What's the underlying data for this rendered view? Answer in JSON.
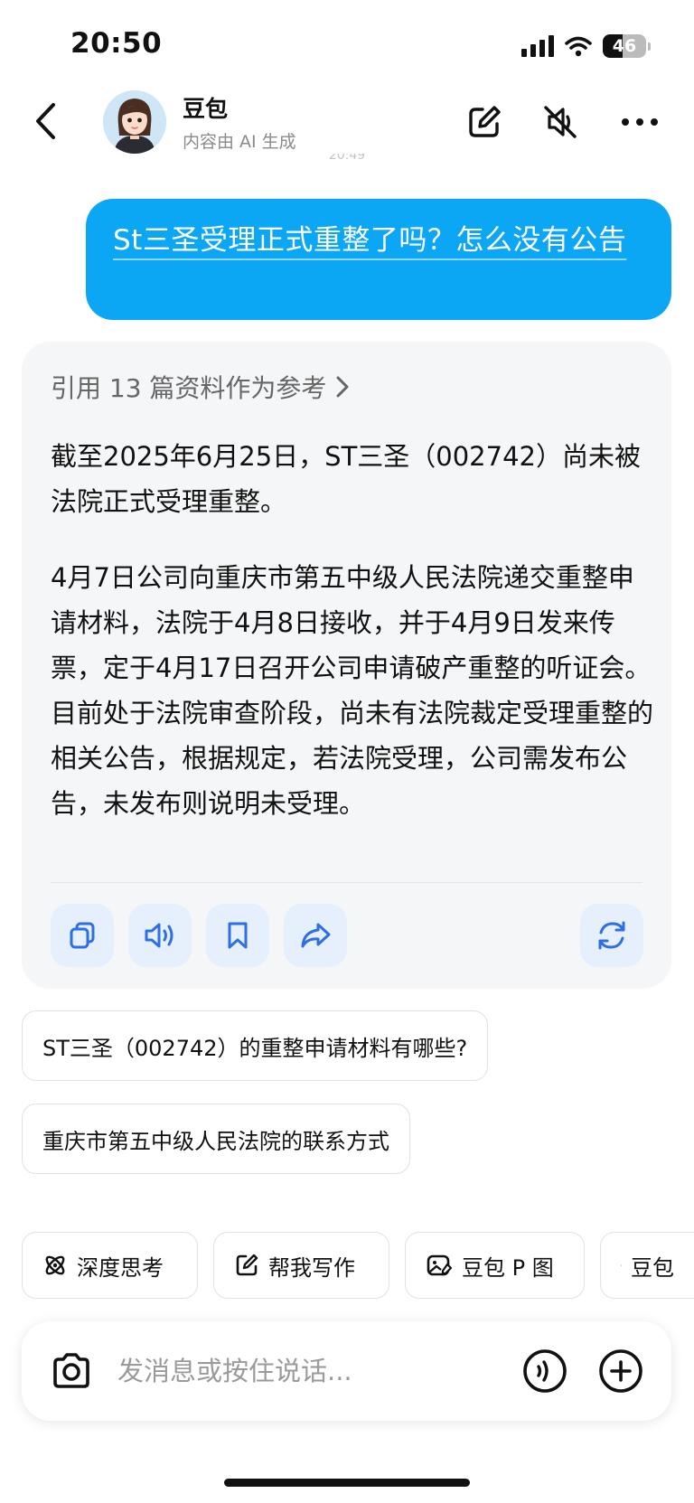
{
  "status_bar": {
    "time": "20:50",
    "battery_level": "46",
    "battery_fraction": 0.46
  },
  "header": {
    "title": "豆包",
    "subtitle": "内容由 AI 生成",
    "timestamp_peek": "20:49"
  },
  "user_message": {
    "text": "St三圣受理正式重整了吗？怎么没有公告"
  },
  "answer": {
    "references_label": "引用 13 篇资料作为参考",
    "paragraph1": "截至2025年6月25日，ST三圣（002742）尚未被法院正式受理重整。",
    "paragraph2": "4月7日公司向重庆市第五中级人民法院递交重整申请材料，法院于4月8日接收，并于4月9日发来传票，定于4月17日召开公司申请破产重整的听证会。目前处于法院审查阶段，尚未有法院裁定受理重整的相关公告，根据规定，若法院受理，公司需发布公告，未发布则说明未受理。",
    "actions": [
      "copy-icon",
      "speaker-icon",
      "bookmark-icon",
      "share-icon",
      "regenerate-icon"
    ]
  },
  "suggestions": [
    {
      "label": "ST三圣（002742）的重整申请材料有哪些?"
    },
    {
      "label": "重庆市第五中级人民法院的联系方式"
    }
  ],
  "chips": [
    {
      "label": "深度思考",
      "icon": "atom-icon"
    },
    {
      "label": "帮我写作",
      "icon": "pen-square-icon"
    },
    {
      "label": "豆包 P 图",
      "icon": "image-edit-icon"
    },
    {
      "label": "豆包",
      "icon": "document-icon"
    }
  ],
  "input": {
    "placeholder": "发消息或按住说话..."
  },
  "colors": {
    "accent": "#0ba7f5",
    "card_bg": "#f5f6f8",
    "action_bg": "#e6effc",
    "action_icon": "#2f6fe3"
  }
}
